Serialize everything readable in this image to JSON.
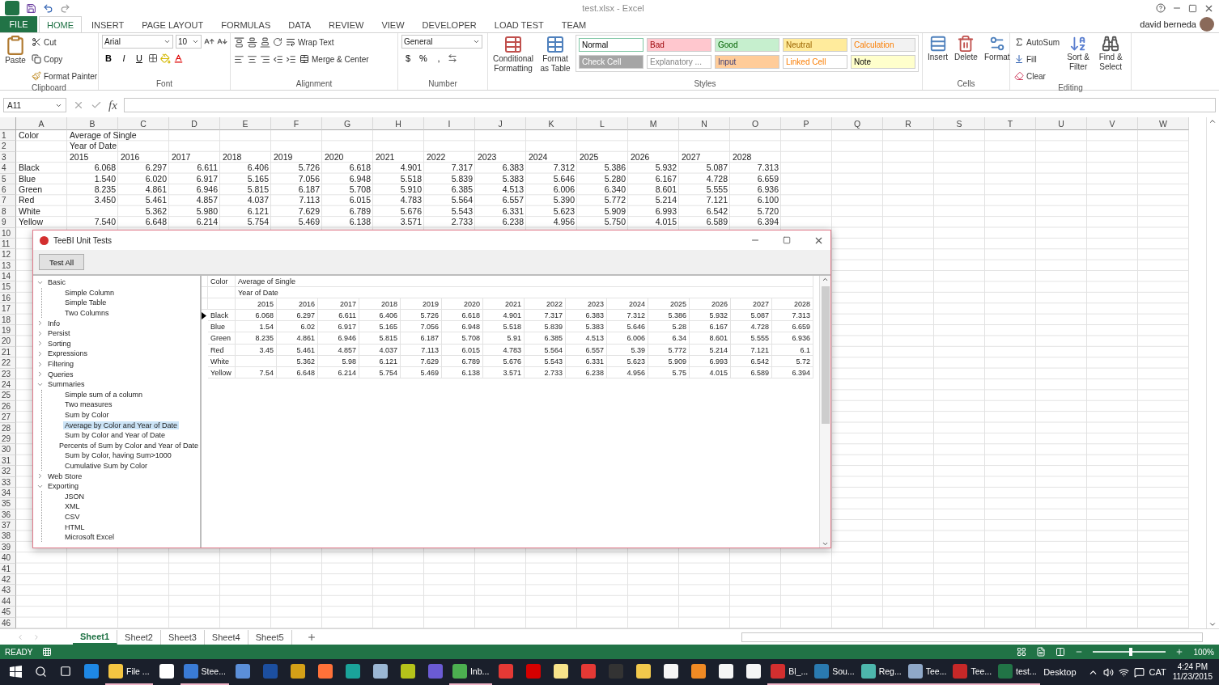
{
  "window": {
    "title": "test.xlsx - Excel",
    "user": "david berneda"
  },
  "file_tab": "FILE",
  "tabs": [
    {
      "label": "HOME",
      "selected": true
    },
    {
      "label": "INSERT",
      "selected": false
    },
    {
      "label": "PAGE LAYOUT",
      "selected": false
    },
    {
      "label": "FORMULAS",
      "selected": false
    },
    {
      "label": "DATA",
      "selected": false
    },
    {
      "label": "REVIEW",
      "selected": false
    },
    {
      "label": "VIEW",
      "selected": false
    },
    {
      "label": "DEVELOPER",
      "selected": false
    },
    {
      "label": "LOAD TEST",
      "selected": false
    },
    {
      "label": "TEAM",
      "selected": false
    }
  ],
  "ribbon": {
    "clipboard": {
      "title": "Clipboard",
      "paste": "Paste",
      "cut": "Cut",
      "copy": "Copy",
      "format_painter": "Format Painter"
    },
    "font": {
      "title": "Font",
      "font_name": "Arial",
      "font_size": "10",
      "format_buttons": [
        "B",
        "I",
        "U"
      ]
    },
    "alignment": {
      "title": "Alignment",
      "wrap_text": "Wrap Text",
      "merge_center": "Merge & Center"
    },
    "number": {
      "title": "Number",
      "format": "General",
      "symbols": [
        "$",
        "%",
        ","
      ]
    },
    "styles": {
      "title": "Styles",
      "conditional": "Conditional Formatting",
      "format_table": "Format as Table",
      "cell_styles": [
        {
          "label": "Normal",
          "kind": "normal",
          "color": "#ffffff"
        },
        {
          "label": "Bad",
          "kind": "bad",
          "color": "#ffc7ce"
        },
        {
          "label": "Good",
          "kind": "good",
          "color": "#c6efce"
        },
        {
          "label": "Neutral",
          "kind": "neutral",
          "color": "#ffeb9c"
        },
        {
          "label": "Calculation",
          "kind": "calculation",
          "color": "#f2f2f2"
        },
        {
          "label": "Check Cell",
          "kind": "check",
          "color": "#a5a5a5"
        },
        {
          "label": "Explanatory ...",
          "kind": "explanatory",
          "color": "#ffffff"
        },
        {
          "label": "Input",
          "kind": "input",
          "color": "#ffcc99"
        },
        {
          "label": "Linked Cell",
          "kind": "linked",
          "color": "#ffffff"
        },
        {
          "label": "Note",
          "kind": "note",
          "color": "#ffffcc"
        }
      ]
    },
    "cells": {
      "title": "Cells",
      "buttons": [
        "Insert",
        "Delete",
        "Format"
      ]
    },
    "editing": {
      "title": "Editing",
      "autosum": "AutoSum",
      "fill": "Fill",
      "clear": "Clear",
      "sort": "Sort & Filter",
      "find": "Find & Select"
    }
  },
  "formula_bar": {
    "name_box": "A11",
    "fx": "fx"
  },
  "sheet": {
    "columns": [
      "A",
      "B",
      "C",
      "D",
      "E",
      "F",
      "G",
      "H",
      "I",
      "J",
      "K",
      "L",
      "M",
      "N",
      "O",
      "P",
      "Q",
      "R",
      "S",
      "T",
      "U",
      "V",
      "W"
    ],
    "row_numbers": [
      "1",
      "2",
      "3",
      "4",
      "5",
      "6",
      "7",
      "8",
      "9",
      "10",
      "11",
      "12",
      "13",
      "14",
      "15",
      "16",
      "17",
      "18",
      "19",
      "20",
      "21",
      "22",
      "23",
      "24",
      "25",
      "26",
      "27",
      "28",
      "29",
      "30",
      "31",
      "32",
      "33",
      "34",
      "35",
      "36",
      "37",
      "38",
      "39",
      "40",
      "41",
      "42",
      "43",
      "44",
      "45",
      "46"
    ],
    "rows": [
      {
        "kind": "header",
        "label": "Color",
        "skip_first": false,
        "values": [
          "Average of Single"
        ]
      },
      {
        "kind": "header",
        "skip_first": false,
        "values": [
          "Year of Date"
        ]
      },
      {
        "kind": "header",
        "skip_first": false,
        "values": [
          "2015",
          "2016",
          "2017",
          "2018",
          "2019",
          "2020",
          "2021",
          "2022",
          "2023",
          "2024",
          "2025",
          "2026",
          "2027",
          "2028"
        ]
      },
      {
        "kind": "data",
        "label": "Black",
        "skip_first": false,
        "values": [
          "6.068",
          "6.297",
          "6.611",
          "6.406",
          "5.726",
          "6.618",
          "4.901",
          "7.317",
          "6.383",
          "7.312",
          "5.386",
          "5.932",
          "5.087",
          "7.313"
        ]
      },
      {
        "kind": "data",
        "label": "Blue",
        "skip_first": false,
        "values": [
          "1.540",
          "6.020",
          "6.917",
          "5.165",
          "7.056",
          "6.948",
          "5.518",
          "5.839",
          "5.383",
          "5.646",
          "5.280",
          "6.167",
          "4.728",
          "6.659"
        ]
      },
      {
        "kind": "data",
        "label": "Green",
        "skip_first": false,
        "values": [
          "8.235",
          "4.861",
          "6.946",
          "5.815",
          "6.187",
          "5.708",
          "5.910",
          "6.385",
          "4.513",
          "6.006",
          "6.340",
          "8.601",
          "5.555",
          "6.936"
        ]
      },
      {
        "kind": "data",
        "label": "Red",
        "skip_first": false,
        "values": [
          "3.450",
          "5.461",
          "4.857",
          "4.037",
          "7.113",
          "6.015",
          "4.783",
          "5.564",
          "6.557",
          "5.390",
          "5.772",
          "5.214",
          "7.121",
          "6.100"
        ]
      },
      {
        "kind": "data",
        "label": "White",
        "skip_first": true,
        "values": [
          "5.362",
          "5.980",
          "6.121",
          "7.629",
          "6.789",
          "5.676",
          "5.543",
          "6.331",
          "5.623",
          "5.909",
          "6.993",
          "6.542",
          "5.720"
        ]
      },
      {
        "kind": "data",
        "label": "Yellow",
        "skip_first": false,
        "values": [
          "7.540",
          "6.648",
          "6.214",
          "5.754",
          "5.469",
          "6.138",
          "3.571",
          "2.733",
          "6.238",
          "4.956",
          "5.750",
          "4.015",
          "6.589",
          "6.394"
        ]
      }
    ]
  },
  "dialog": {
    "title": "TeeBI Unit Tests",
    "button": "Test All",
    "tree": [
      {
        "label": "Basic",
        "expanded": true,
        "selected": false,
        "children": [
          {
            "label": "Simple Column",
            "selected": false
          },
          {
            "label": "Simple Table",
            "selected": false
          },
          {
            "label": "Two Columns",
            "selected": false
          }
        ]
      },
      {
        "label": "Info",
        "expanded": false,
        "selected": false
      },
      {
        "label": "Persist",
        "expanded": false,
        "selected": false
      },
      {
        "label": "Sorting",
        "expanded": false,
        "selected": false
      },
      {
        "label": "Expressions",
        "expanded": false,
        "selected": false
      },
      {
        "label": "Filtering",
        "expanded": false,
        "selected": false
      },
      {
        "label": "Queries",
        "expanded": false,
        "selected": false
      },
      {
        "label": "Summaries",
        "expanded": true,
        "selected": false,
        "children": [
          {
            "label": "Simple sum of a column",
            "selected": false
          },
          {
            "label": "Two measures",
            "selected": false
          },
          {
            "label": "Sum by Color",
            "selected": false
          },
          {
            "label": "Average by Color and Year of Date",
            "selected": true
          },
          {
            "label": "Sum by Color and Year of Date",
            "selected": false
          },
          {
            "label": "Percents of Sum by Color and Year of Date",
            "selected": false
          },
          {
            "label": "Sum by Color, having Sum>1000",
            "selected": false
          },
          {
            "label": "Cumulative Sum by Color",
            "selected": false
          }
        ]
      },
      {
        "label": "Web Store",
        "expanded": false,
        "selected": false
      },
      {
        "label": "Exporting",
        "expanded": true,
        "selected": false,
        "children": [
          {
            "label": "JSON",
            "selected": false
          },
          {
            "label": "XML",
            "selected": false
          },
          {
            "label": "CSV",
            "selected": false
          },
          {
            "label": "HTML",
            "selected": false
          },
          {
            "label": "Microsoft Excel",
            "selected": false
          }
        ]
      }
    ],
    "grid": {
      "corner": "Color",
      "measure": "Average of Single",
      "dimension": "Year of Date",
      "years": [
        "2015",
        "2016",
        "2017",
        "2018",
        "2019",
        "2020",
        "2021",
        "2022",
        "2023",
        "2024",
        "2025",
        "2026",
        "2027",
        "2028"
      ],
      "rows": [
        {
          "label": "Black",
          "selected": true,
          "skip_first": false,
          "values": [
            "6.068",
            "6.297",
            "6.611",
            "6.406",
            "5.726",
            "6.618",
            "4.901",
            "7.317",
            "6.383",
            "7.312",
            "5.386",
            "5.932",
            "5.087",
            "7.313"
          ]
        },
        {
          "label": "Blue",
          "selected": false,
          "skip_first": false,
          "values": [
            "1.54",
            "6.02",
            "6.917",
            "5.165",
            "7.056",
            "6.948",
            "5.518",
            "5.839",
            "5.383",
            "5.646",
            "5.28",
            "6.167",
            "4.728",
            "6.659"
          ]
        },
        {
          "label": "Green",
          "selected": false,
          "skip_first": false,
          "values": [
            "8.235",
            "4.861",
            "6.946",
            "5.815",
            "6.187",
            "5.708",
            "5.91",
            "6.385",
            "4.513",
            "6.006",
            "6.34",
            "8.601",
            "5.555",
            "6.936"
          ]
        },
        {
          "label": "Red",
          "selected": false,
          "skip_first": false,
          "values": [
            "3.45",
            "5.461",
            "4.857",
            "4.037",
            "7.113",
            "6.015",
            "4.783",
            "5.564",
            "6.557",
            "5.39",
            "5.772",
            "5.214",
            "7.121",
            "6.1"
          ]
        },
        {
          "label": "White",
          "selected": false,
          "skip_first": true,
          "values": [
            "5.362",
            "5.98",
            "6.121",
            "7.629",
            "6.789",
            "5.676",
            "5.543",
            "6.331",
            "5.623",
            "5.909",
            "6.993",
            "6.542",
            "5.72"
          ]
        },
        {
          "label": "Yellow",
          "selected": false,
          "skip_first": false,
          "values": [
            "7.54",
            "6.648",
            "6.214",
            "5.754",
            "5.469",
            "6.138",
            "3.571",
            "2.733",
            "6.238",
            "4.956",
            "5.75",
            "4.015",
            "6.589",
            "6.394"
          ]
        }
      ]
    }
  },
  "sheet_tabs": [
    {
      "label": "Sheet1",
      "selected": true
    },
    {
      "label": "Sheet2",
      "selected": false
    },
    {
      "label": "Sheet3",
      "selected": false
    },
    {
      "label": "Sheet4",
      "selected": false
    },
    {
      "label": "Sheet5",
      "selected": false
    }
  ],
  "status_bar": {
    "mode": "READY",
    "zoom": "100%",
    "zoom_level": {
      "level": 0.5
    }
  },
  "taskbar": {
    "items": [
      {
        "color": "#1e88e5",
        "running": false
      },
      {
        "label": "File ...",
        "color": "#f4c542",
        "running": true
      },
      {
        "color": "#ffffff",
        "running": false
      },
      {
        "label": "Stee...",
        "color": "#3a7bd5",
        "running": true
      },
      {
        "color": "#5b8fd9",
        "running": false
      },
      {
        "color": "#1c4fa0",
        "running": false
      },
      {
        "color": "#d4a017",
        "running": false
      },
      {
        "color": "#ff7139",
        "running": false
      },
      {
        "color": "#1aa39a",
        "running": false
      },
      {
        "color": "#9bb7d4",
        "running": false
      },
      {
        "color": "#b5c31a",
        "running": false
      },
      {
        "color": "#6b5bd4",
        "running": false
      },
      {
        "label": "Inb...",
        "color": "#4caf50",
        "running": true
      },
      {
        "color": "#e53935",
        "running": false
      },
      {
        "color": "#d50000",
        "running": false
      },
      {
        "color": "#f7e38a",
        "running": false
      },
      {
        "color": "#e53935",
        "running": false
      },
      {
        "color": "#333333",
        "running": false
      },
      {
        "color": "#f2c94c",
        "running": false
      },
      {
        "color": "#f5f5f5",
        "running": false
      },
      {
        "color": "#f08a24",
        "running": false
      },
      {
        "color": "#f5f5f5",
        "running": false
      },
      {
        "color": "#f5f5f5",
        "running": false
      },
      {
        "label": "Bl_...",
        "color": "#d32f2f",
        "running": true
      },
      {
        "label": "Sou...",
        "color": "#2a7ab0",
        "running": true
      },
      {
        "label": "Reg...",
        "color": "#4db6ac",
        "running": true
      },
      {
        "label": "Tee...",
        "color": "#8fa8c8",
        "running": true
      },
      {
        "label": "Tee...",
        "color": "#c62828",
        "running": true
      },
      {
        "label": "test...",
        "color": "#217346",
        "running": true
      }
    ],
    "desktop": "Desktop",
    "language": "CAT",
    "time": "4:24 PM",
    "date": "11/23/2015"
  }
}
